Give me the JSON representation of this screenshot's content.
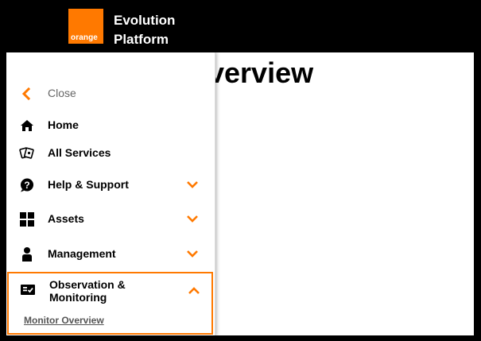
{
  "header": {
    "logo_text": "orange",
    "brand_line1": "Evolution",
    "brand_line2": "Platform",
    "brand_color": "#ff7900"
  },
  "main": {
    "title": "Overview"
  },
  "sidebar": {
    "close_label": "Close",
    "items": [
      {
        "label": "Home",
        "icon": "home-icon",
        "expandable": false
      },
      {
        "label": "All Services",
        "icon": "services-icon",
        "expandable": false
      },
      {
        "label": "Help & Support",
        "icon": "help-icon",
        "expandable": true
      },
      {
        "label": "Assets",
        "icon": "grid-icon",
        "expandable": true
      },
      {
        "label": "Management",
        "icon": "person-icon",
        "expandable": true
      }
    ],
    "expanded_item": {
      "label": "Observation & Monitoring",
      "icon": "monitor-check-icon",
      "sub_items": [
        {
          "label": "Monitor Overview"
        }
      ]
    }
  },
  "colors": {
    "accent": "#ff7900",
    "background": "#000000",
    "panel": "#ffffff"
  }
}
